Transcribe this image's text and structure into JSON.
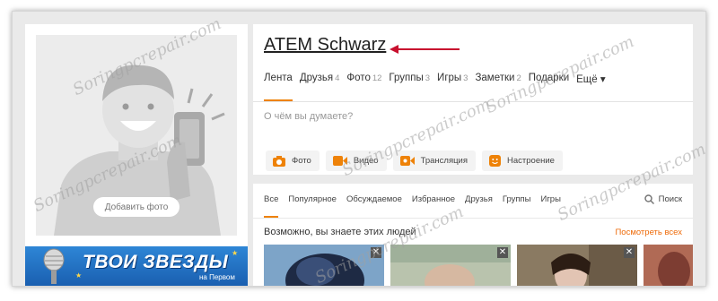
{
  "profile": {
    "name": "ATEM Schwarz",
    "add_photo_label": "Добавить фото"
  },
  "tabs": [
    {
      "label": "Лента",
      "count": "",
      "active": true
    },
    {
      "label": "Друзья",
      "count": "4"
    },
    {
      "label": "Фото",
      "count": "12"
    },
    {
      "label": "Группы",
      "count": "3"
    },
    {
      "label": "Игры",
      "count": "3"
    },
    {
      "label": "Заметки",
      "count": "2"
    },
    {
      "label": "Подарки",
      "count": ""
    },
    {
      "label": "Ещё ▾",
      "count": ""
    }
  ],
  "post": {
    "placeholder": "О чём вы думаете?",
    "actions": [
      {
        "label": "Фото",
        "icon": "camera-icon"
      },
      {
        "label": "Видео",
        "icon": "video-icon"
      },
      {
        "label": "Трансляция",
        "icon": "broadcast-icon"
      },
      {
        "label": "Настроение",
        "icon": "smiley-icon"
      }
    ]
  },
  "feed": {
    "tabs": [
      "Все",
      "Популярное",
      "Обсуждаемое",
      "Избранное",
      "Друзья",
      "Группы",
      "Игры"
    ],
    "search_label": "Поиск",
    "people_title": "Возможно, вы знаете этих людей",
    "people_link": "Посмотреть всех",
    "close_glyph": "✕"
  },
  "banner": {
    "title": "ТВОИ ЗВЕЗДЫ",
    "subtitle": "на Первом"
  },
  "watermark": "Soringpcrepair.com",
  "colors": {
    "accent": "#ee8208",
    "link": "#ee6a08",
    "arrow": "#c8102e",
    "banner": "#1f6fc4"
  }
}
